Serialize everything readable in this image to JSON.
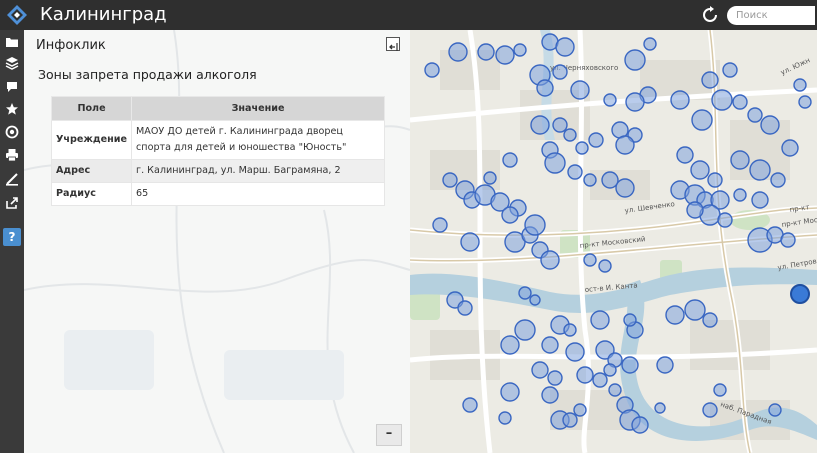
{
  "app": {
    "title": "Калининград"
  },
  "search": {
    "placeholder": "Поиск"
  },
  "panel": {
    "title": "Инфоклик",
    "layer_title": "Зоны запрета продажи алкоголя",
    "table": {
      "headers": [
        "Поле",
        "Значение"
      ],
      "rows": [
        {
          "field": "Учреждение",
          "value": "МАОУ ДО детей г. Калининграда дворец спорта для детей и юношества \"Юность\""
        },
        {
          "field": "Адрес",
          "value": "г. Калининград, ул. Марш. Баграмяна, 2"
        },
        {
          "field": "Радиус",
          "value": "65"
        }
      ]
    },
    "minimize_label": "–"
  },
  "toolbar": {
    "help_label": "?",
    "icons": [
      "folder-icon",
      "layers-icon",
      "comment-icon",
      "star-icon",
      "target-icon",
      "print-icon",
      "measure-icon",
      "share-icon"
    ]
  },
  "map": {
    "labels": {
      "cherniakhovskogo": "ул. Черняховского",
      "shevchenko": "ул. Шевченко",
      "moskovsky": "пр-кт Московский",
      "moskovsky_right": "пр-кт Мос",
      "kanta": "ост-в И. Канта",
      "petrov": "ул. Петров",
      "paradnaya": "наб. Парадная",
      "pr_kt": "пр-кт",
      "ul_yuzhn": "ул. Южн"
    }
  },
  "colors": {
    "circle_fill": "#7fa3dd",
    "circle_stroke": "#3a67c2",
    "water": "#b5d0de",
    "topbar": "#2f2f2f"
  }
}
